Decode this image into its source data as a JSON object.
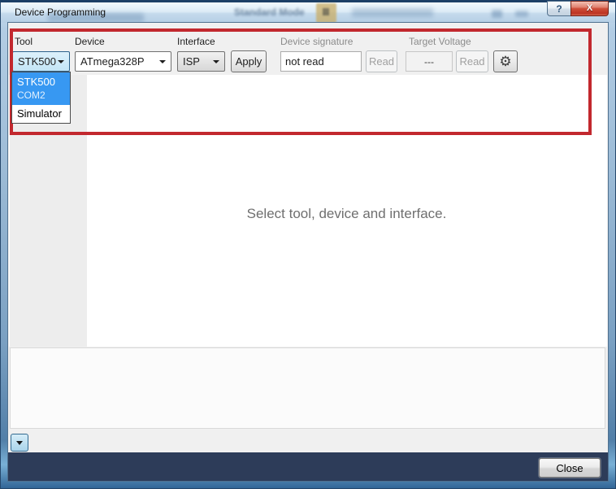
{
  "window": {
    "title": "Device Programming",
    "help_button": "?",
    "close_button": "X"
  },
  "background_window": {
    "ghost_tab_label": "Standard Mode"
  },
  "toolbar": {
    "tool_label": "Tool",
    "tool_value": "STK500",
    "device_label": "Device",
    "device_value": "ATmega328P",
    "interface_label": "Interface",
    "interface_value": "ISP",
    "apply_button": "Apply",
    "device_signature_label": "Device signature",
    "device_signature_value": "not read",
    "signature_read_button": "Read",
    "target_voltage_label": "Target Voltage",
    "target_voltage_value": "---",
    "voltage_read_button": "Read",
    "settings_icon": "⚙"
  },
  "tool_dropdown": {
    "items": [
      {
        "name": "STK500",
        "port": "COM2",
        "highlighted": true
      },
      {
        "name": "Simulator",
        "highlighted": false
      }
    ]
  },
  "main": {
    "hint": "Select tool, device and interface."
  },
  "footer": {
    "close_button": "Close"
  },
  "colors": {
    "highlight_box": "#c2282e",
    "selection_blue": "#3798f2",
    "footer_bar": "#2d3c59",
    "close_caption_red": "#c63b2a",
    "toolbar_bg": "#f0f0f0"
  }
}
